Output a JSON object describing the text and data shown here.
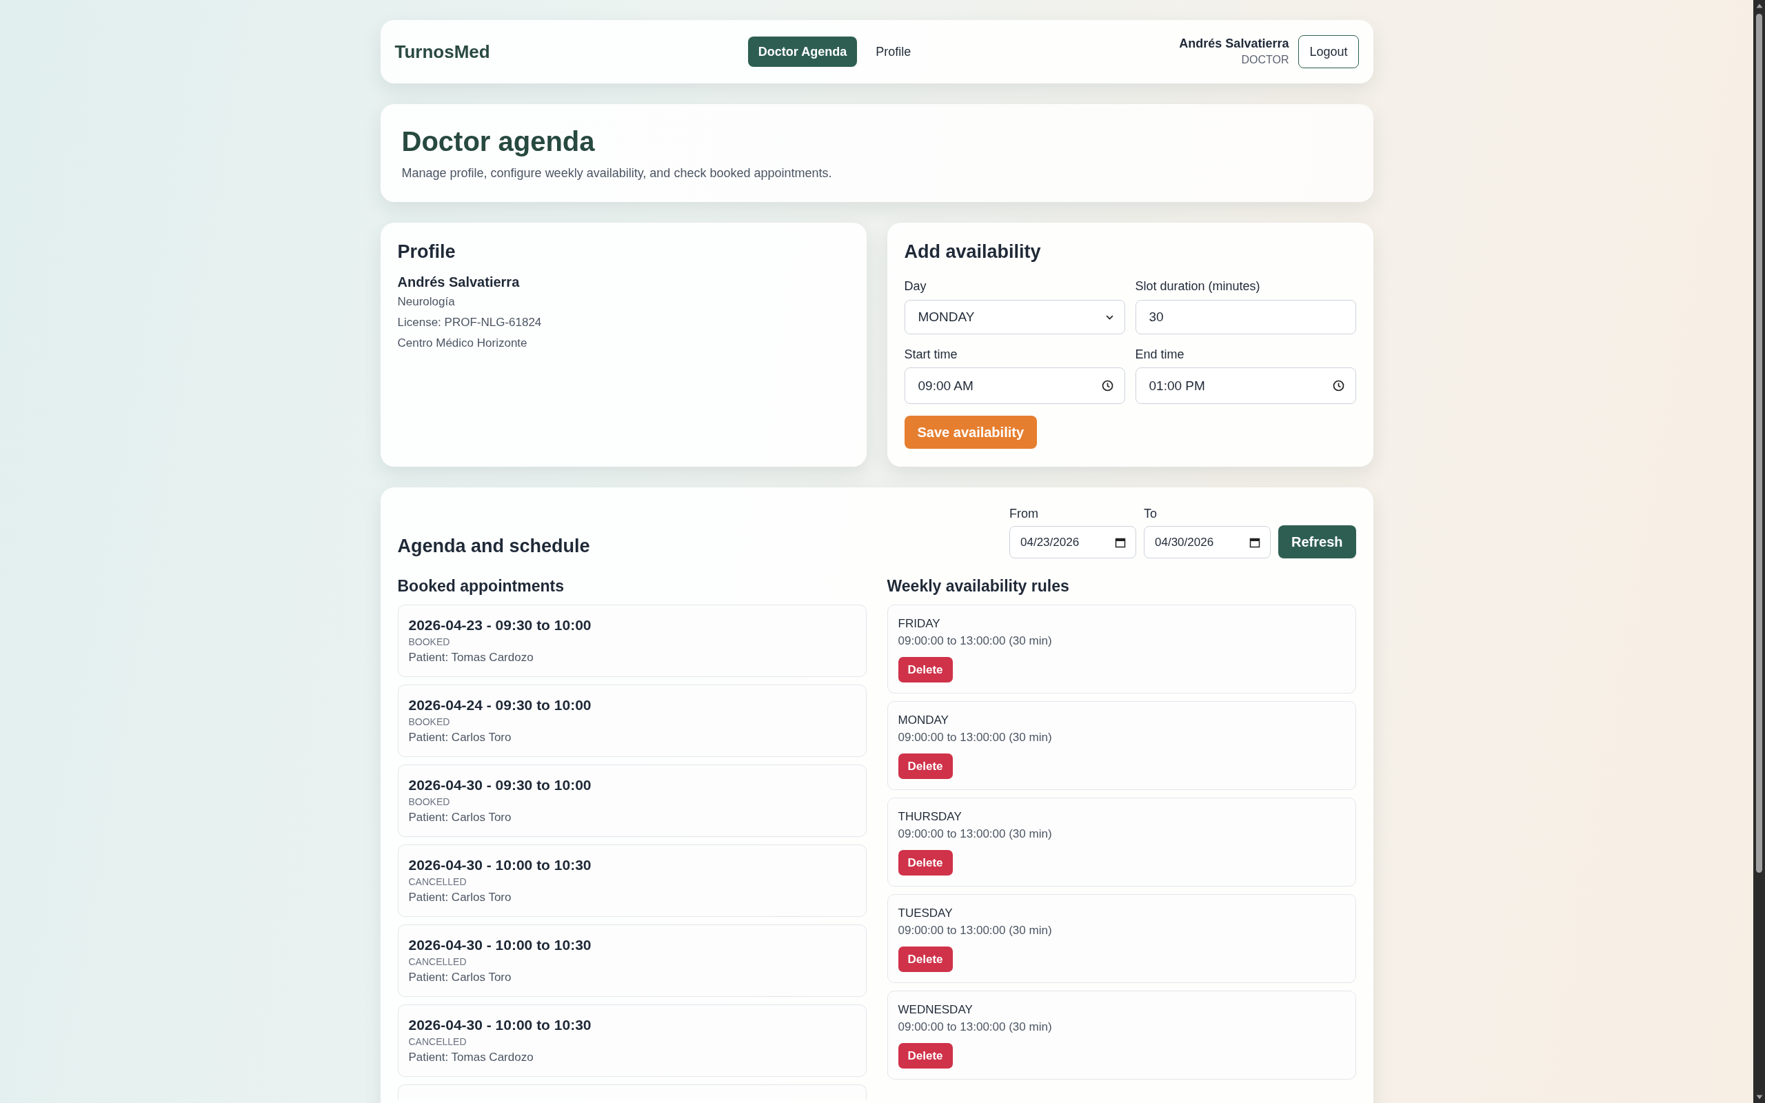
{
  "nav": {
    "brand": "TurnosMed",
    "links": [
      {
        "label": "Doctor Agenda",
        "selected": true
      },
      {
        "label": "Profile",
        "selected": false
      }
    ],
    "user": {
      "name": "Andrés Salvatierra",
      "role": "DOCTOR"
    },
    "logout": "Logout"
  },
  "header": {
    "title": "Doctor agenda",
    "subtitle": "Manage profile, configure weekly availability, and check booked appointments."
  },
  "profile": {
    "title": "Profile",
    "name": "Andrés Salvatierra",
    "lines": [
      "Neurología",
      "License: PROF-NLG-61824",
      "Centro Médico Horizonte"
    ]
  },
  "availability_form": {
    "title": "Add availability",
    "fields": [
      {
        "label": "Day",
        "kind": "select",
        "value": "MONDAY"
      },
      {
        "label": "Slot duration (minutes)",
        "kind": "number",
        "value": "30"
      },
      {
        "label": "Start time",
        "kind": "time",
        "value": "09:00 AM"
      },
      {
        "label": "End time",
        "kind": "time",
        "value": "01:00 PM"
      }
    ],
    "submit": "Save availability"
  },
  "agenda": {
    "title": "Agenda and schedule",
    "range": [
      {
        "label": "From",
        "kind": "date",
        "value": "04/23/2026"
      },
      {
        "label": "To",
        "kind": "date",
        "value": "04/30/2026"
      }
    ],
    "refresh": "Refresh",
    "appointments": {
      "title": "Booked appointments",
      "items": [
        {
          "kind": "full",
          "when": "2026-04-23 - 09:30 to 10:00",
          "status": "BOOKED",
          "patient": "Patient: Tomas Cardozo"
        },
        {
          "kind": "full",
          "when": "2026-04-24 - 09:30 to 10:00",
          "status": "BOOKED",
          "patient": "Patient: Carlos Toro"
        },
        {
          "kind": "full",
          "when": "2026-04-30 - 09:30 to 10:00",
          "status": "BOOKED",
          "patient": "Patient: Carlos Toro"
        },
        {
          "kind": "full",
          "when": "2026-04-30 - 10:00 to 10:30",
          "status": "CANCELLED",
          "patient": "Patient: Carlos Toro"
        },
        {
          "kind": "full",
          "when": "2026-04-30 - 10:00 to 10:30",
          "status": "CANCELLED",
          "patient": "Patient: Carlos Toro"
        },
        {
          "kind": "full",
          "when": "2026-04-30 - 10:00 to 10:30",
          "status": "CANCELLED",
          "patient": "Patient: Tomas Cardozo"
        },
        {
          "kind": "clipped"
        }
      ]
    },
    "rules": {
      "title": "Weekly availability rules",
      "items": [
        {
          "day": "FRIDAY",
          "hours": "09:00:00 to 13:00:00 (30 min)",
          "action": "Delete"
        },
        {
          "day": "MONDAY",
          "hours": "09:00:00 to 13:00:00 (30 min)",
          "action": "Delete"
        },
        {
          "day": "THURSDAY",
          "hours": "09:00:00 to 13:00:00 (30 min)",
          "action": "Delete"
        },
        {
          "day": "TUESDAY",
          "hours": "09:00:00 to 13:00:00 (30 min)",
          "action": "Delete"
        },
        {
          "day": "WEDNESDAY",
          "hours": "09:00:00 to 13:00:00 (30 min)",
          "action": "Delete"
        }
      ]
    }
  }
}
